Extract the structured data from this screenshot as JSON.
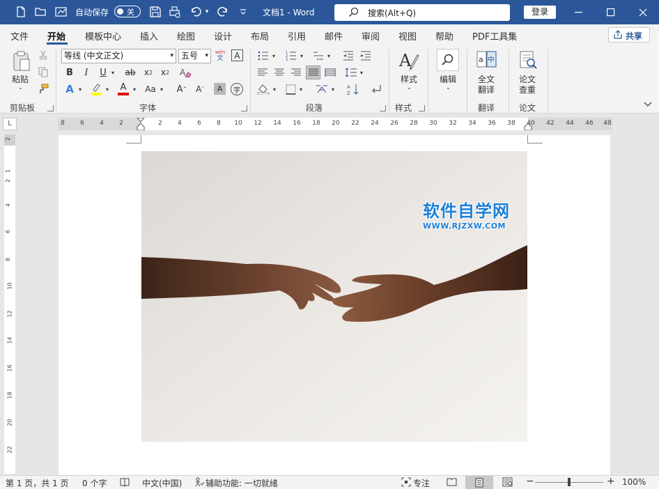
{
  "titlebar": {
    "autosave_label": "自动保存",
    "autosave_state": "关",
    "doc_title": "文档1  -  Word",
    "search_placeholder": "搜索(Alt+Q)",
    "login_label": "登录",
    "icons": [
      "file-icon",
      "open-folder-icon",
      "pen-icon",
      "save-icon",
      "print-preview-icon",
      "undo-icon",
      "redo-icon",
      "customize-icon",
      "search-icon",
      "minimize-icon",
      "maximize-icon",
      "close-icon"
    ]
  },
  "tabs": [
    "文件",
    "开始",
    "模板中心",
    "插入",
    "绘图",
    "设计",
    "布局",
    "引用",
    "邮件",
    "审阅",
    "视图",
    "帮助",
    "PDF工具集"
  ],
  "active_tab": "开始",
  "share_label": "共享",
  "ribbon": {
    "clipboard": {
      "paste": "粘贴",
      "group": "剪贴板"
    },
    "font": {
      "name": "等线 (中文正文)",
      "size": "五号",
      "phonetic_top": "wén",
      "phonetic_bottom": "文",
      "group": "字体"
    },
    "paragraph": {
      "group": "段落"
    },
    "styles": {
      "label": "样式",
      "group": "样式"
    },
    "editing": {
      "label": "编辑"
    },
    "translate": {
      "full_line1": "全文",
      "full_line2": "翻译",
      "group": "翻译"
    },
    "thesis": {
      "line1": "论文",
      "line2": "查重",
      "group": "论文"
    }
  },
  "ruler": {
    "corner": "L",
    "h_ticks": [
      "8",
      "6",
      "4",
      "2",
      "2",
      "4",
      "6",
      "8",
      "10",
      "12",
      "14",
      "16",
      "18",
      "20",
      "22",
      "24",
      "26",
      "28",
      "30",
      "32",
      "34",
      "36",
      "38",
      "40",
      "42",
      "44",
      "46",
      "48"
    ],
    "v_ticks": [
      "2",
      "1",
      "2",
      "4",
      "6",
      "8",
      "10",
      "12",
      "14",
      "16",
      "18",
      "20",
      "22"
    ]
  },
  "watermark": {
    "title": "软件自学网",
    "url": "WWW.RJZXW.COM"
  },
  "statusbar": {
    "page": "第 1 页，共 1 页",
    "words": "0 个字",
    "language": "中文(中国)",
    "accessibility": "辅助功能: 一切就绪",
    "focus": "专注",
    "zoom": "100%"
  }
}
